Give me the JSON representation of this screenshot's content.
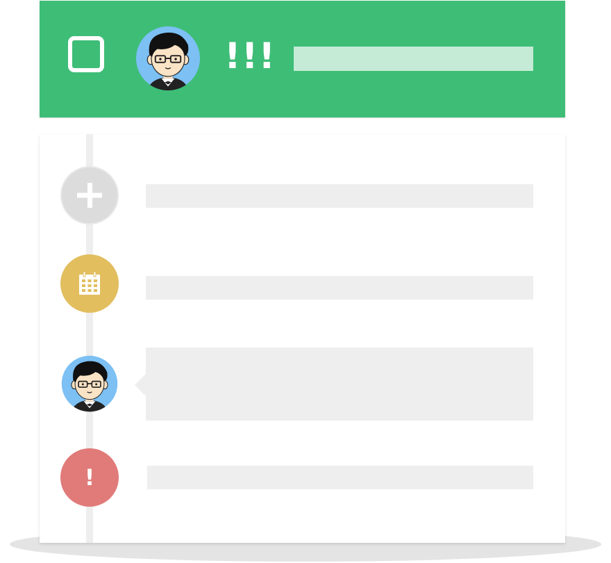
{
  "header": {
    "alert_text": "!!!",
    "accent_color": "#3ebd77",
    "checkbox_icon": "checkbox-icon",
    "avatar_icon": "user-avatar-icon"
  },
  "timeline": {
    "items": [
      {
        "icon": "plus-icon",
        "color": "#dcdcdc"
      },
      {
        "icon": "calendar-icon",
        "color": "#e2be5f"
      },
      {
        "icon": "user-avatar-icon",
        "color": "#7fc0f2"
      },
      {
        "icon": "exclamation-icon",
        "color": "#e07b79",
        "label": "!"
      }
    ]
  }
}
